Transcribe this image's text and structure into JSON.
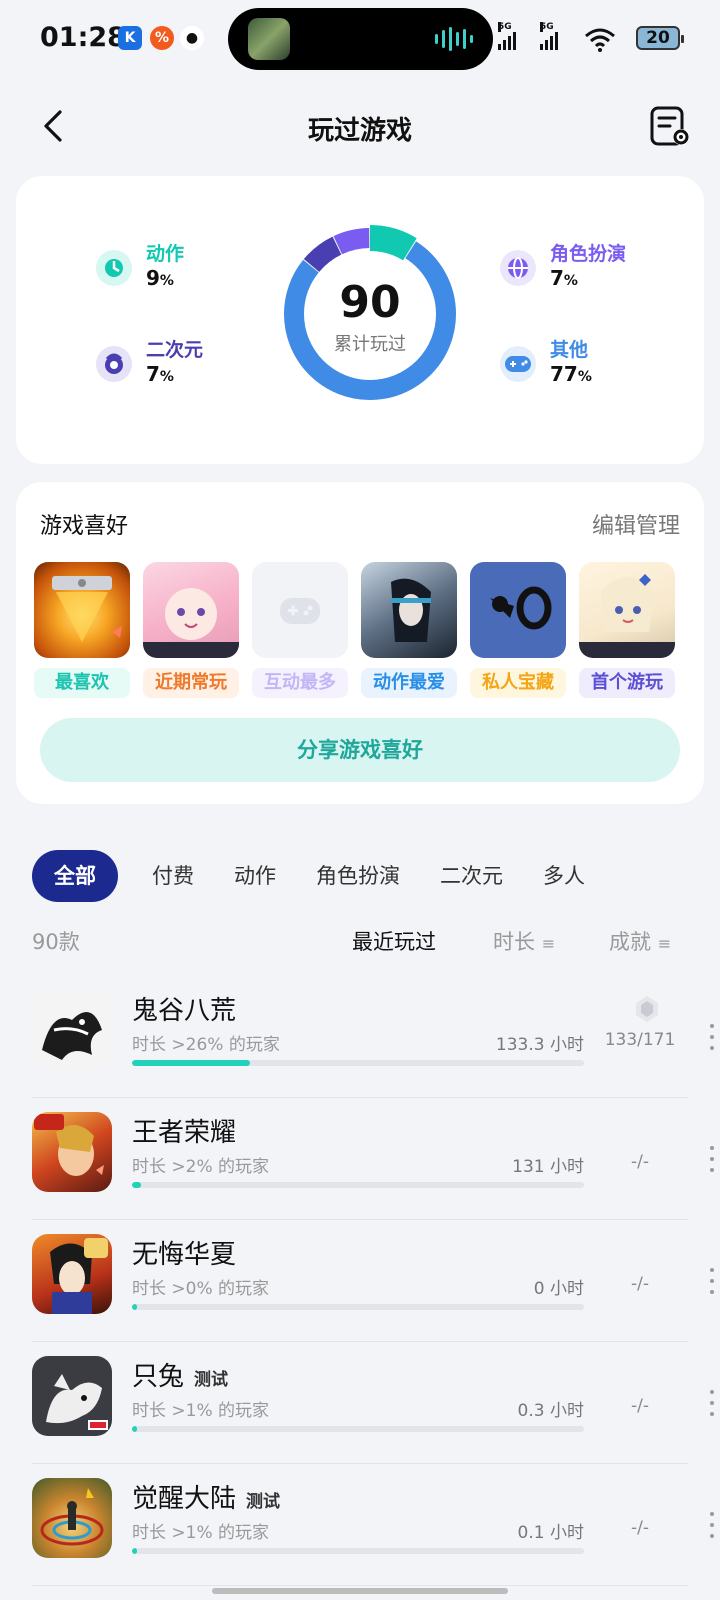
{
  "status": {
    "time": "01:28",
    "network1": "5G",
    "network2": "5G",
    "battery": "20"
  },
  "header": {
    "title": "玩过游戏"
  },
  "stats": {
    "total": "90",
    "total_label": "累计玩过",
    "categories": [
      {
        "name": "动作",
        "value": "9",
        "unit": "%",
        "color": "#10c9b0"
      },
      {
        "name": "角色扮演",
        "value": "7",
        "unit": "%",
        "color": "#7b5cf0"
      },
      {
        "name": "二次元",
        "value": "7",
        "unit": "%",
        "color": "#4a3fb0"
      },
      {
        "name": "其他",
        "value": "77",
        "unit": "%",
        "color": "#3f8be6"
      }
    ]
  },
  "prefs": {
    "title": "游戏喜好",
    "edit": "编辑管理",
    "items": [
      {
        "tag": "最喜欢",
        "color": "#1ec4b0",
        "bg": "#e6faf6"
      },
      {
        "tag": "近期常玩",
        "color": "#f07a2c",
        "bg": "#fff1e6"
      },
      {
        "tag": "互动最多",
        "color": "#c4b6f6",
        "bg": "#f5f2fd"
      },
      {
        "tag": "动作最爱",
        "color": "#2b8fe8",
        "bg": "#e8f3fd"
      },
      {
        "tag": "私人宝藏",
        "color": "#f3a514",
        "bg": "#fff6e0"
      },
      {
        "tag": "首个游玩",
        "color": "#5b4fd6",
        "bg": "#efedfb"
      }
    ],
    "share": "分享游戏喜好"
  },
  "tabs": [
    "全部",
    "付费",
    "动作",
    "角色扮演",
    "二次元",
    "多人"
  ],
  "list": {
    "count": "90款",
    "sort_recent": "最近玩过",
    "sort_duration": "时长",
    "sort_achievement": "成就"
  },
  "games": [
    {
      "name": "鬼谷八荒",
      "badge": "",
      "desc": "时长 >26% 的玩家",
      "hours": "133.3 小时",
      "achievement": "133/171",
      "progress": 0.26
    },
    {
      "name": "王者荣耀",
      "badge": "",
      "desc": "时长 >2% 的玩家",
      "hours": "131 小时",
      "achievement": "-/-",
      "progress": 0.02
    },
    {
      "name": "无悔华夏",
      "badge": "",
      "desc": "时长 >0% 的玩家",
      "hours": "0 小时",
      "achievement": "-/-",
      "progress": 0.0
    },
    {
      "name": "只兔",
      "badge": "测试",
      "desc": "时长 >1% 的玩家",
      "hours": "0.3 小时",
      "achievement": "-/-",
      "progress": 0.01
    },
    {
      "name": "觉醒大陆",
      "badge": "测试",
      "desc": "时长 >1% 的玩家",
      "hours": "0.1 小时",
      "achievement": "-/-",
      "progress": 0.01
    }
  ]
}
